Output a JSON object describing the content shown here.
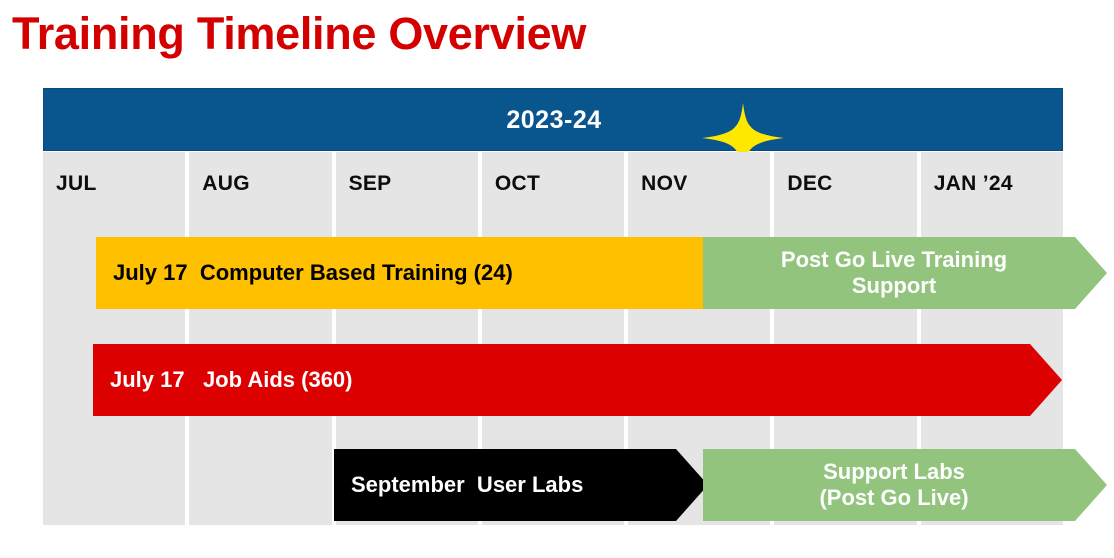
{
  "title": "Training Timeline Overview",
  "timeline": {
    "year_label": "2023-24",
    "sparkle_icon": "sparkle-star-icon",
    "months": [
      {
        "label": "JUL"
      },
      {
        "label": "AUG"
      },
      {
        "label": "SEP"
      },
      {
        "label": "OCT"
      },
      {
        "label": "NOV"
      },
      {
        "label": "DEC"
      },
      {
        "label": "JAN ’24"
      }
    ],
    "bars": [
      {
        "id": "cbt",
        "label": "July 17  Computer Based Training (24)",
        "color": "#FFC000",
        "text_color": "#000000",
        "start_month": "JUL",
        "end_month": "NOV"
      },
      {
        "id": "post-go-live-training",
        "label": "Post Go Live Training\nSupport",
        "color": "#92C47D",
        "text_color": "#FFFFFF",
        "start_month": "NOV",
        "end_month": "JAN ’24"
      },
      {
        "id": "job-aids",
        "label": "July 17   Job Aids (360)",
        "color": "#DD0000",
        "text_color": "#FFFFFF",
        "start_month": "JUL",
        "end_month": "JAN ’24"
      },
      {
        "id": "user-labs",
        "label": "September  User Labs",
        "color": "#000000",
        "text_color": "#FFFFFF",
        "start_month": "SEP",
        "end_month": "NOV"
      },
      {
        "id": "support-labs",
        "label": "Support Labs\n(Post Go Live)",
        "color": "#92C47D",
        "text_color": "#FFFFFF",
        "start_month": "NOV",
        "end_month": "JAN ’24"
      }
    ]
  },
  "colors": {
    "title": "#D40000",
    "header_bar": "#09558D",
    "grid_cell": "#E5E5E5",
    "sparkle": "#FFE800"
  }
}
